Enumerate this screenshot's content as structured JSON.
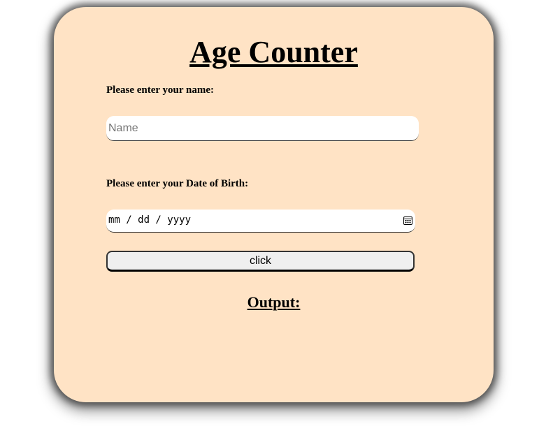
{
  "app": {
    "title": "Age Counter"
  },
  "form": {
    "name_label": "Please enter your name:",
    "name_placeholder": "Name",
    "name_value": "",
    "dob_label": "Please enter your Date of Birth:",
    "dob_placeholder": "mm / dd / yyyy",
    "button_label": "click"
  },
  "output": {
    "heading": "Output:",
    "value": ""
  },
  "colors": {
    "card_background": "#ffe3c5",
    "button_background": "#efefef"
  },
  "icons": {
    "date_picker": "calendar-icon"
  }
}
